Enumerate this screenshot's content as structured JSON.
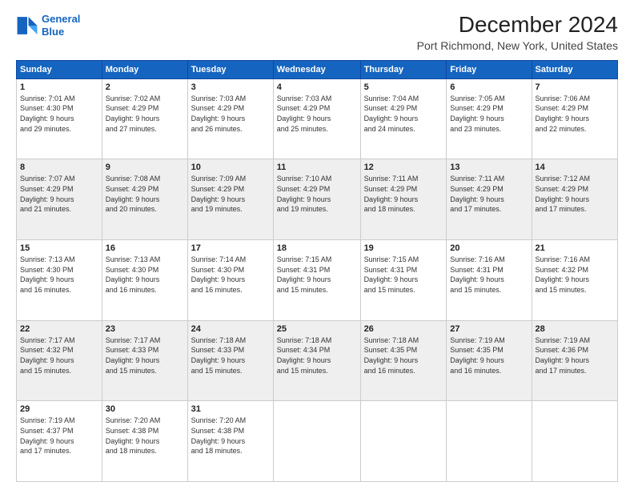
{
  "logo": {
    "line1": "General",
    "line2": "Blue"
  },
  "title": "December 2024",
  "subtitle": "Port Richmond, New York, United States",
  "days_of_week": [
    "Sunday",
    "Monday",
    "Tuesday",
    "Wednesday",
    "Thursday",
    "Friday",
    "Saturday"
  ],
  "weeks": [
    [
      {
        "day": "1",
        "info": "Sunrise: 7:01 AM\nSunset: 4:30 PM\nDaylight: 9 hours\nand 29 minutes."
      },
      {
        "day": "2",
        "info": "Sunrise: 7:02 AM\nSunset: 4:29 PM\nDaylight: 9 hours\nand 27 minutes."
      },
      {
        "day": "3",
        "info": "Sunrise: 7:03 AM\nSunset: 4:29 PM\nDaylight: 9 hours\nand 26 minutes."
      },
      {
        "day": "4",
        "info": "Sunrise: 7:03 AM\nSunset: 4:29 PM\nDaylight: 9 hours\nand 25 minutes."
      },
      {
        "day": "5",
        "info": "Sunrise: 7:04 AM\nSunset: 4:29 PM\nDaylight: 9 hours\nand 24 minutes."
      },
      {
        "day": "6",
        "info": "Sunrise: 7:05 AM\nSunset: 4:29 PM\nDaylight: 9 hours\nand 23 minutes."
      },
      {
        "day": "7",
        "info": "Sunrise: 7:06 AM\nSunset: 4:29 PM\nDaylight: 9 hours\nand 22 minutes."
      }
    ],
    [
      {
        "day": "8",
        "info": "Sunrise: 7:07 AM\nSunset: 4:29 PM\nDaylight: 9 hours\nand 21 minutes."
      },
      {
        "day": "9",
        "info": "Sunrise: 7:08 AM\nSunset: 4:29 PM\nDaylight: 9 hours\nand 20 minutes."
      },
      {
        "day": "10",
        "info": "Sunrise: 7:09 AM\nSunset: 4:29 PM\nDaylight: 9 hours\nand 19 minutes."
      },
      {
        "day": "11",
        "info": "Sunrise: 7:10 AM\nSunset: 4:29 PM\nDaylight: 9 hours\nand 19 minutes."
      },
      {
        "day": "12",
        "info": "Sunrise: 7:11 AM\nSunset: 4:29 PM\nDaylight: 9 hours\nand 18 minutes."
      },
      {
        "day": "13",
        "info": "Sunrise: 7:11 AM\nSunset: 4:29 PM\nDaylight: 9 hours\nand 17 minutes."
      },
      {
        "day": "14",
        "info": "Sunrise: 7:12 AM\nSunset: 4:29 PM\nDaylight: 9 hours\nand 17 minutes."
      }
    ],
    [
      {
        "day": "15",
        "info": "Sunrise: 7:13 AM\nSunset: 4:30 PM\nDaylight: 9 hours\nand 16 minutes."
      },
      {
        "day": "16",
        "info": "Sunrise: 7:13 AM\nSunset: 4:30 PM\nDaylight: 9 hours\nand 16 minutes."
      },
      {
        "day": "17",
        "info": "Sunrise: 7:14 AM\nSunset: 4:30 PM\nDaylight: 9 hours\nand 16 minutes."
      },
      {
        "day": "18",
        "info": "Sunrise: 7:15 AM\nSunset: 4:31 PM\nDaylight: 9 hours\nand 15 minutes."
      },
      {
        "day": "19",
        "info": "Sunrise: 7:15 AM\nSunset: 4:31 PM\nDaylight: 9 hours\nand 15 minutes."
      },
      {
        "day": "20",
        "info": "Sunrise: 7:16 AM\nSunset: 4:31 PM\nDaylight: 9 hours\nand 15 minutes."
      },
      {
        "day": "21",
        "info": "Sunrise: 7:16 AM\nSunset: 4:32 PM\nDaylight: 9 hours\nand 15 minutes."
      }
    ],
    [
      {
        "day": "22",
        "info": "Sunrise: 7:17 AM\nSunset: 4:32 PM\nDaylight: 9 hours\nand 15 minutes."
      },
      {
        "day": "23",
        "info": "Sunrise: 7:17 AM\nSunset: 4:33 PM\nDaylight: 9 hours\nand 15 minutes."
      },
      {
        "day": "24",
        "info": "Sunrise: 7:18 AM\nSunset: 4:33 PM\nDaylight: 9 hours\nand 15 minutes."
      },
      {
        "day": "25",
        "info": "Sunrise: 7:18 AM\nSunset: 4:34 PM\nDaylight: 9 hours\nand 15 minutes."
      },
      {
        "day": "26",
        "info": "Sunrise: 7:18 AM\nSunset: 4:35 PM\nDaylight: 9 hours\nand 16 minutes."
      },
      {
        "day": "27",
        "info": "Sunrise: 7:19 AM\nSunset: 4:35 PM\nDaylight: 9 hours\nand 16 minutes."
      },
      {
        "day": "28",
        "info": "Sunrise: 7:19 AM\nSunset: 4:36 PM\nDaylight: 9 hours\nand 17 minutes."
      }
    ],
    [
      {
        "day": "29",
        "info": "Sunrise: 7:19 AM\nSunset: 4:37 PM\nDaylight: 9 hours\nand 17 minutes."
      },
      {
        "day": "30",
        "info": "Sunrise: 7:20 AM\nSunset: 4:38 PM\nDaylight: 9 hours\nand 18 minutes."
      },
      {
        "day": "31",
        "info": "Sunrise: 7:20 AM\nSunset: 4:38 PM\nDaylight: 9 hours\nand 18 minutes."
      },
      null,
      null,
      null,
      null
    ]
  ]
}
